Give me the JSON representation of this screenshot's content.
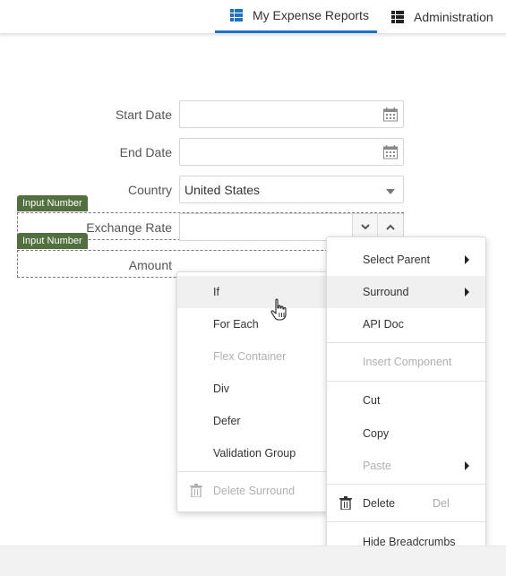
{
  "nav": {
    "tabs": [
      {
        "label": "My Expense Reports",
        "icon": "grid-list-icon",
        "active": true
      },
      {
        "label": "Administration",
        "icon": "grid-list-icon",
        "active": false
      }
    ],
    "accent_color": "#1a73c8"
  },
  "form": {
    "start_date_label": "Start Date",
    "end_date_label": "End Date",
    "country_label": "Country",
    "country_value": "United States",
    "exchange_rate_label": "Exchange Rate",
    "amount_label": "Amount",
    "badge_label": "Input Number",
    "badge_color": "#52703e"
  },
  "context_menu": {
    "items": [
      {
        "label": "Select Parent",
        "submenu": true
      },
      {
        "label": "Surround",
        "submenu": true,
        "highlighted": true
      },
      {
        "label": "API Doc"
      },
      {
        "label": "Insert Component",
        "disabled": true
      },
      {
        "label": "Cut"
      },
      {
        "label": "Copy"
      },
      {
        "label": "Paste",
        "submenu": true,
        "disabled": true
      },
      {
        "label": "Delete",
        "shortcut": "Del",
        "icon": "trash-icon"
      },
      {
        "label": "Hide Breadcrumbs"
      }
    ]
  },
  "surround_menu": {
    "items": [
      {
        "label": "If",
        "highlighted": true
      },
      {
        "label": "For Each"
      },
      {
        "label": "Flex Container",
        "disabled": true
      },
      {
        "label": "Div"
      },
      {
        "label": "Defer"
      },
      {
        "label": "Validation Group"
      },
      {
        "label": "Delete Surround",
        "disabled": true,
        "icon": "trash-icon"
      }
    ]
  }
}
